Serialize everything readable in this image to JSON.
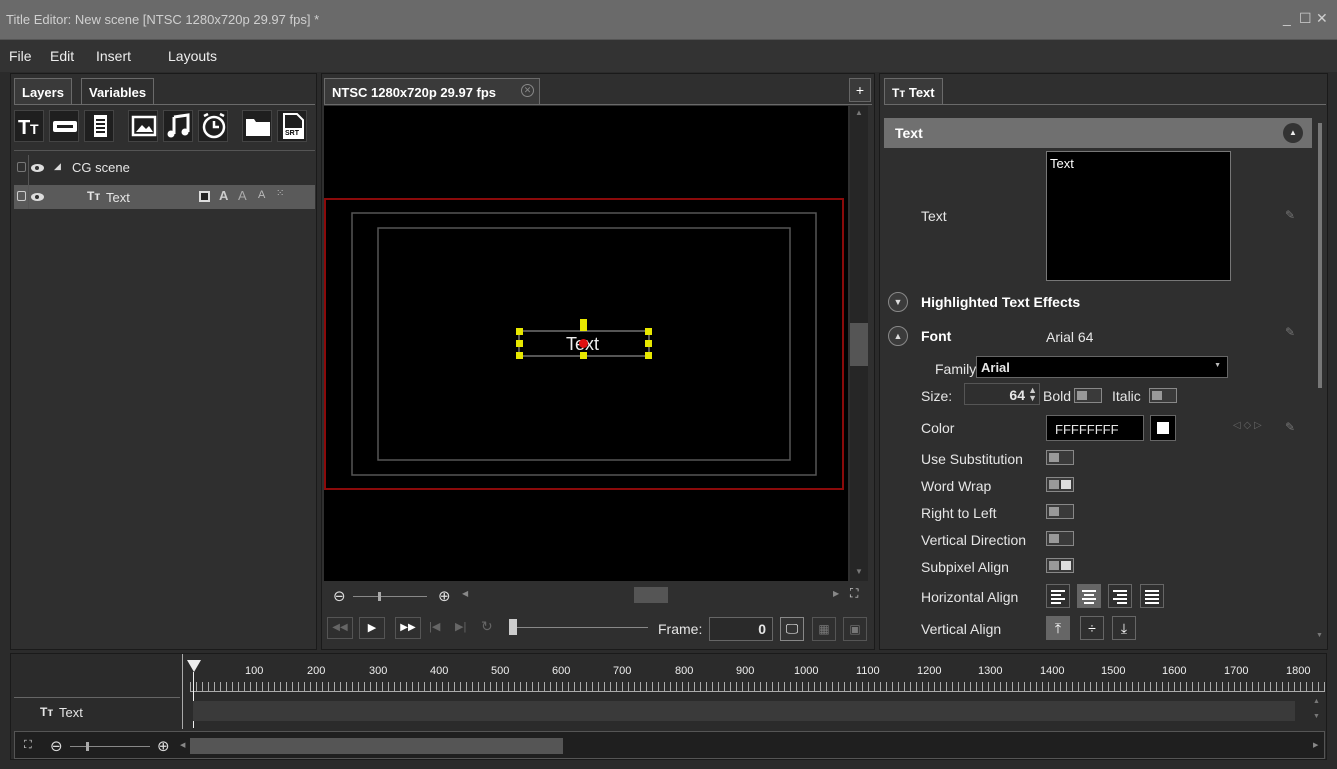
{
  "window": {
    "title": "Title Editor: New scene [NTSC 1280x720p 29.97 fps] *",
    "controls": [
      "_",
      "☐",
      "✕"
    ]
  },
  "menu": [
    "File",
    "Edit",
    "Insert",
    "Layouts"
  ],
  "left_panel": {
    "tabs": [
      "Layers",
      "Variables"
    ],
    "tools": [
      "text-tool-icon",
      "caption-tool-icon",
      "scroll-tool-icon",
      "image-tool-icon",
      "audio-tool-icon",
      "clock-tool-icon",
      "folder-tool-icon",
      "srt-tool-icon"
    ],
    "srt_label": "SRT",
    "layers": [
      {
        "label": "CG scene",
        "prefix": "◢"
      },
      {
        "label": "Text",
        "prefix": "Tт"
      }
    ]
  },
  "center": {
    "tab_label": "NTSC 1280x720p 29.97 fps",
    "canvas_text": "Text",
    "frame_label": "Frame:",
    "frame_value": "0"
  },
  "right_panel": {
    "tab_label": "Text",
    "tab_prefix": "Tт",
    "section_title": "Text",
    "text_label": "Text",
    "text_value": "Text",
    "highlighted_effects": "Highlighted Text Effects",
    "font_label": "Font",
    "font_value": "Arial 64",
    "family_label": "Family:",
    "family_value": "Arial",
    "size_label": "Size:",
    "size_value": "64",
    "bold_label": "Bold",
    "italic_label": "Italic",
    "color_label": "Color",
    "color_value": "FFFFFFFF",
    "use_substitution": "Use Substitution",
    "word_wrap": "Word Wrap",
    "right_to_left": "Right to Left",
    "vertical_direction": "Vertical Direction",
    "subpixel_align": "Subpixel Align",
    "horizontal_align": "Horizontal Align",
    "vertical_align": "Vertical Align"
  },
  "timeline": {
    "ruler": [
      "100",
      "200",
      "300",
      "400",
      "500",
      "600",
      "700",
      "800",
      "900",
      "1000",
      "1100",
      "1200",
      "1300",
      "1400",
      "1500",
      "1600",
      "1700",
      "1800"
    ],
    "track_label": "Text",
    "track_prefix": "Tт"
  },
  "colors": {
    "accent_yellow": "#e8e800",
    "safe_area_red": "#8b0a0a",
    "anchor_red": "#e01010"
  }
}
